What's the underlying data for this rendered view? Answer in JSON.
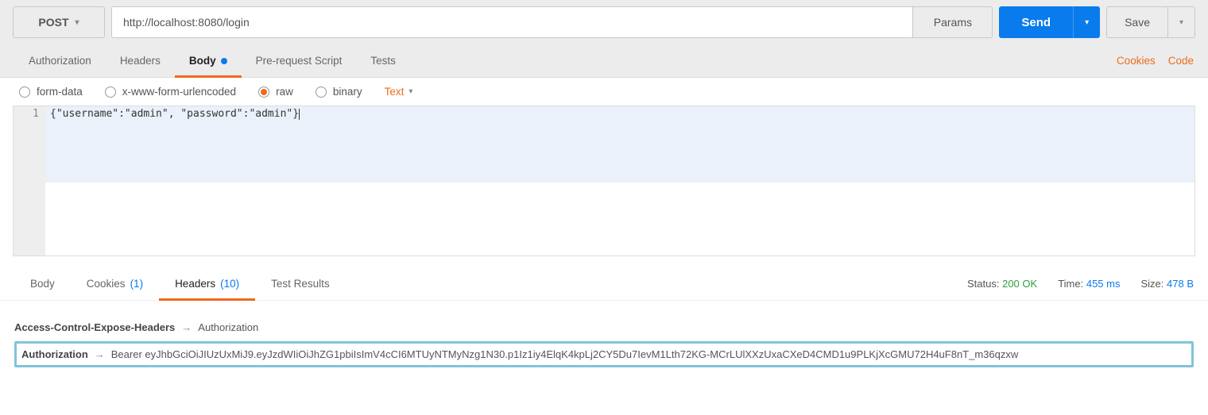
{
  "request": {
    "method": "POST",
    "url": "http://localhost:8080/login",
    "params_label": "Params",
    "send_label": "Send",
    "save_label": "Save"
  },
  "request_tabs": {
    "authorization": "Authorization",
    "headers": "Headers",
    "body": "Body",
    "prerequest": "Pre-request Script",
    "tests": "Tests",
    "cookies_link": "Cookies",
    "code_link": "Code"
  },
  "body_type": {
    "form_data": "form-data",
    "urlencoded": "x-www-form-urlencoded",
    "raw": "raw",
    "binary": "binary",
    "text_dropdown": "Text"
  },
  "editor": {
    "line_number": "1",
    "content": "{\"username\":\"admin\", \"password\":\"admin\"}"
  },
  "response_tabs": {
    "body": "Body",
    "cookies": "Cookies",
    "cookies_count": "(1)",
    "headers": "Headers",
    "headers_count": "(10)",
    "test_results": "Test Results"
  },
  "response_status": {
    "status_label": "Status:",
    "status_value": "200 OK",
    "time_label": "Time:",
    "time_value": "455 ms",
    "size_label": "Size:",
    "size_value": "478 B"
  },
  "response_headers": {
    "row1_key": "Access-Control-Expose-Headers",
    "row1_val": "Authorization",
    "row2_key": "Authorization",
    "row2_val": "Bearer eyJhbGciOiJIUzUxMiJ9.eyJzdWIiOiJhZG1pbiIsImV4cCI6MTUyNTMyNzg1N30.p1Iz1iy4ElqK4kpLj2CY5Du7IevM1Lth72KG-MCrLUlXXzUxaCXeD4CMD1u9PLKjXcGMU72H4uF8nT_m36qzxw"
  }
}
